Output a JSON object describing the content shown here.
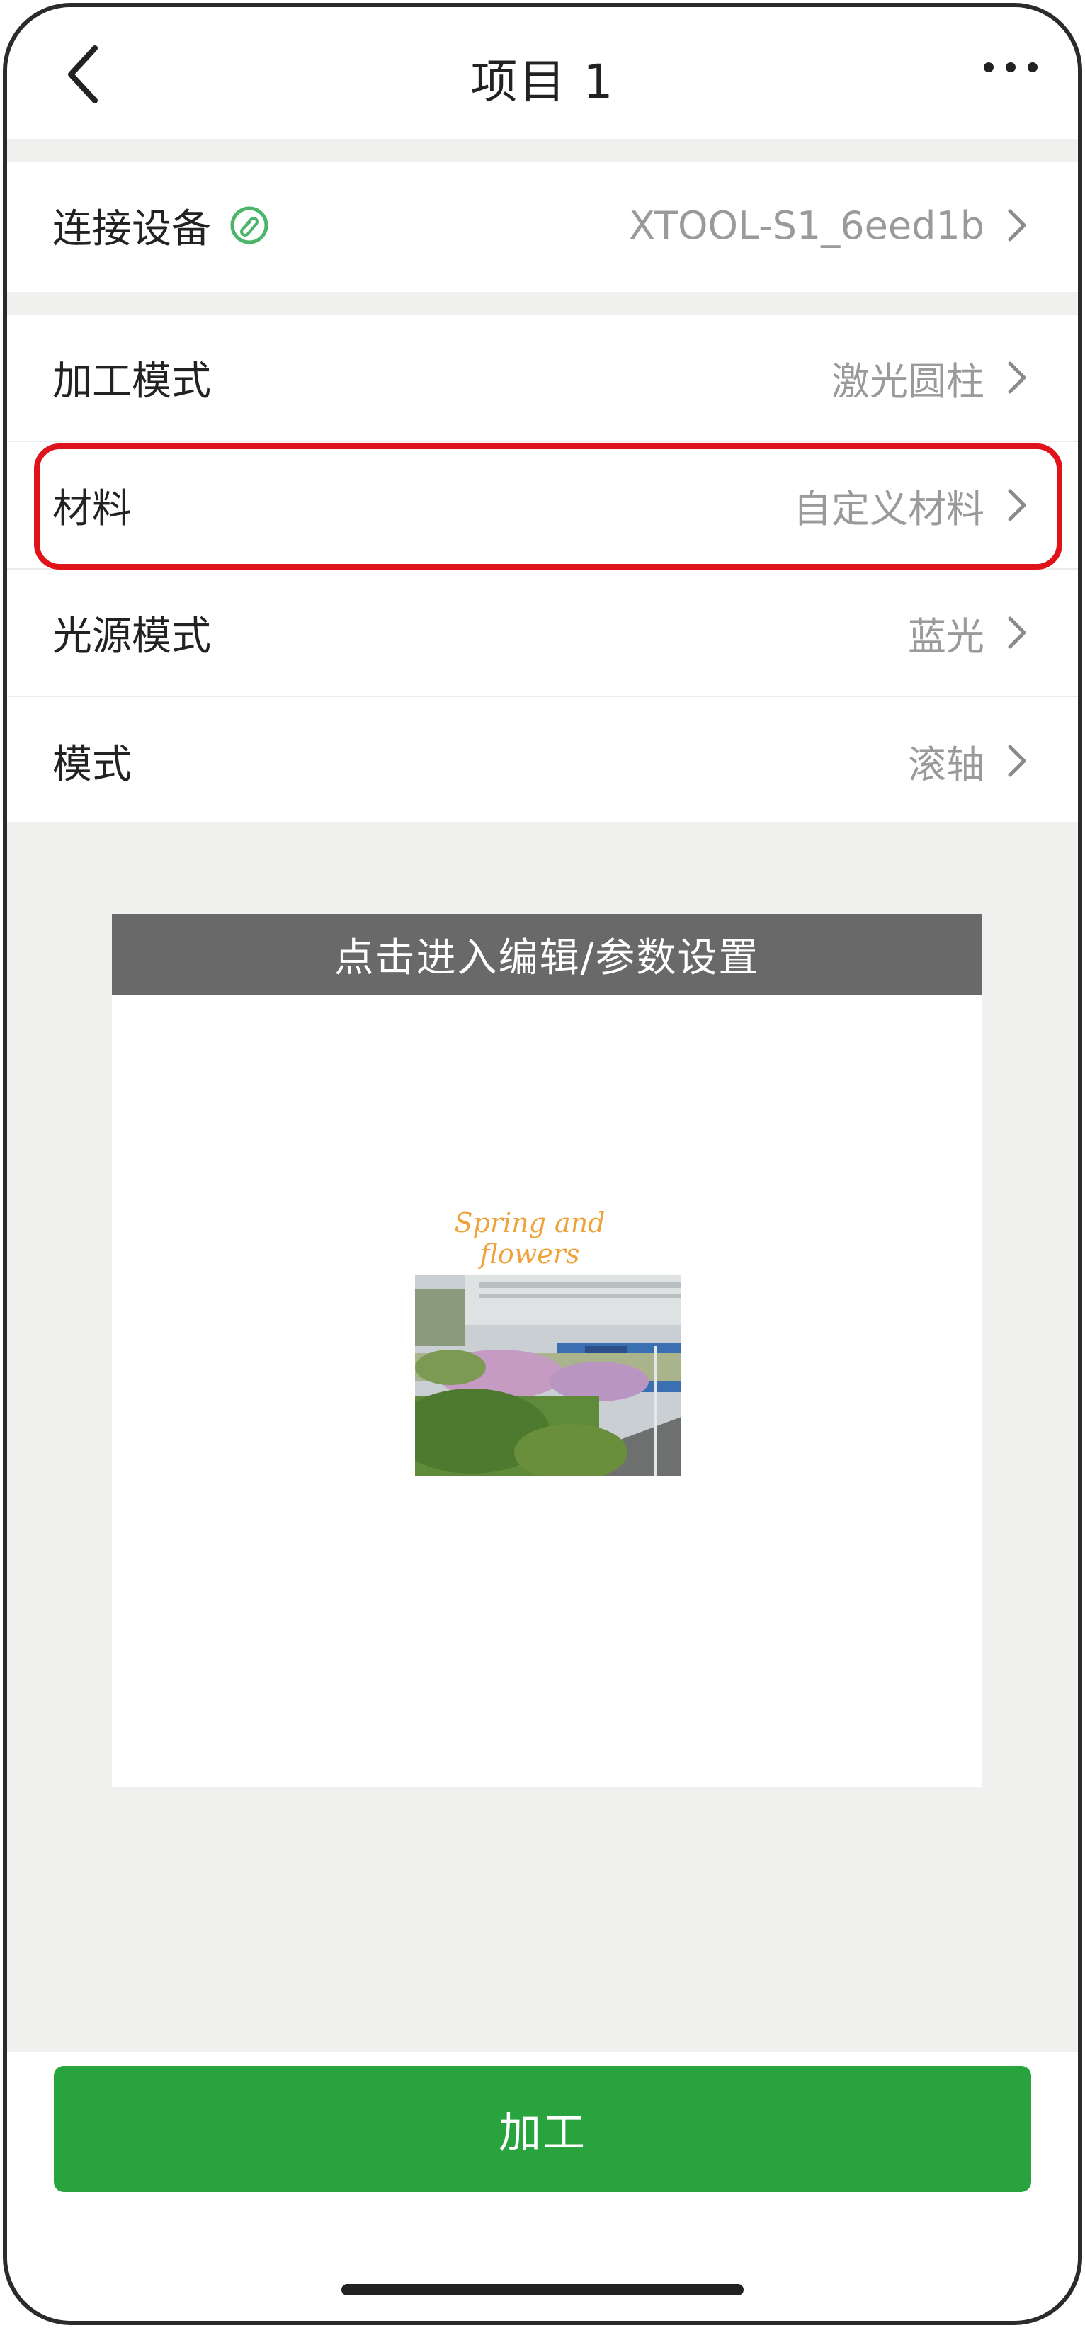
{
  "header": {
    "title": "项目 1",
    "back_icon": "chevron-left-icon",
    "more_icon": "more-horizontal-icon"
  },
  "device": {
    "label": "连接设备",
    "status_icon": "link-connected-icon",
    "value": "XTOOL-S1_6eed1b"
  },
  "settings": [
    {
      "label": "加工模式",
      "value": "激光圆柱"
    },
    {
      "label": "材料",
      "value": "自定义材料",
      "highlighted": true
    },
    {
      "label": "光源模式",
      "value": "蓝光"
    },
    {
      "label": "模式",
      "value": "滚轴"
    }
  ],
  "preview": {
    "banner": "点击进入编辑/参数设置",
    "caption": "Spring and flowers"
  },
  "footer": {
    "process_button": "加工"
  },
  "colors": {
    "accent_green": "#28a33d",
    "highlight_red": "#e0131b",
    "link_icon_green": "#4cb56a",
    "banner_gray": "#686968"
  }
}
